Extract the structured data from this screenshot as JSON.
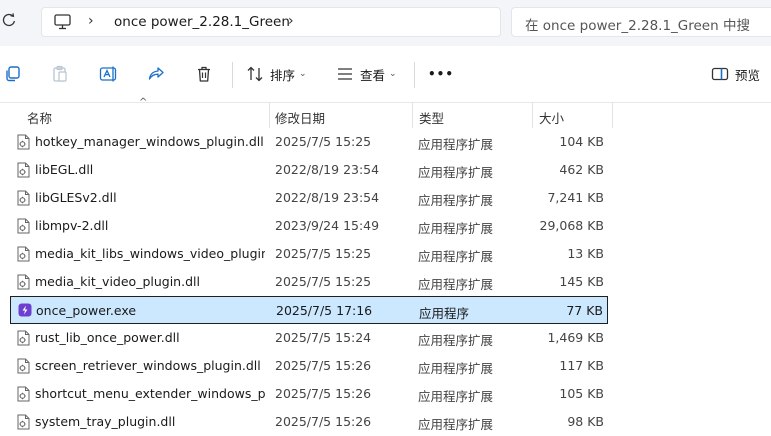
{
  "address": {
    "breadcrumb": "once power_2.28.1_Green",
    "search_placeholder": "在 once power_2.28.1_Green 中搜"
  },
  "toolbar": {
    "sort_label": "排序",
    "view_label": "查看",
    "more_label": "•••",
    "preview_label": "预览"
  },
  "columns": {
    "name": "名称",
    "modified": "修改日期",
    "type": "类型",
    "size": "大小"
  },
  "files": [
    {
      "name": "hotkey_manager_windows_plugin.dll",
      "date": "2025/7/5 15:25",
      "type": "应用程序扩展",
      "size": "104 KB",
      "kind": "dll"
    },
    {
      "name": "libEGL.dll",
      "date": "2022/8/19 23:54",
      "type": "应用程序扩展",
      "size": "462 KB",
      "kind": "dll"
    },
    {
      "name": "libGLESv2.dll",
      "date": "2022/8/19 23:54",
      "type": "应用程序扩展",
      "size": "7,241 KB",
      "kind": "dll"
    },
    {
      "name": "libmpv-2.dll",
      "date": "2023/9/24 15:49",
      "type": "应用程序扩展",
      "size": "29,068 KB",
      "kind": "dll"
    },
    {
      "name": "media_kit_libs_windows_video_plugin....",
      "date": "2025/7/5 15:25",
      "type": "应用程序扩展",
      "size": "13 KB",
      "kind": "dll"
    },
    {
      "name": "media_kit_video_plugin.dll",
      "date": "2025/7/5 15:25",
      "type": "应用程序扩展",
      "size": "145 KB",
      "kind": "dll"
    },
    {
      "name": "once_power.exe",
      "date": "2025/7/5 17:16",
      "type": "应用程序",
      "size": "77 KB",
      "kind": "exe",
      "selected": true
    },
    {
      "name": "rust_lib_once_power.dll",
      "date": "2025/7/5 15:24",
      "type": "应用程序扩展",
      "size": "1,469 KB",
      "kind": "dll"
    },
    {
      "name": "screen_retriever_windows_plugin.dll",
      "date": "2025/7/5 15:26",
      "type": "应用程序扩展",
      "size": "117 KB",
      "kind": "dll"
    },
    {
      "name": "shortcut_menu_extender_windows_pl...",
      "date": "2025/7/5 15:26",
      "type": "应用程序扩展",
      "size": "105 KB",
      "kind": "dll"
    },
    {
      "name": "system_tray_plugin.dll",
      "date": "2025/7/5 15:26",
      "type": "应用程序扩展",
      "size": "98 KB",
      "kind": "dll"
    }
  ]
}
